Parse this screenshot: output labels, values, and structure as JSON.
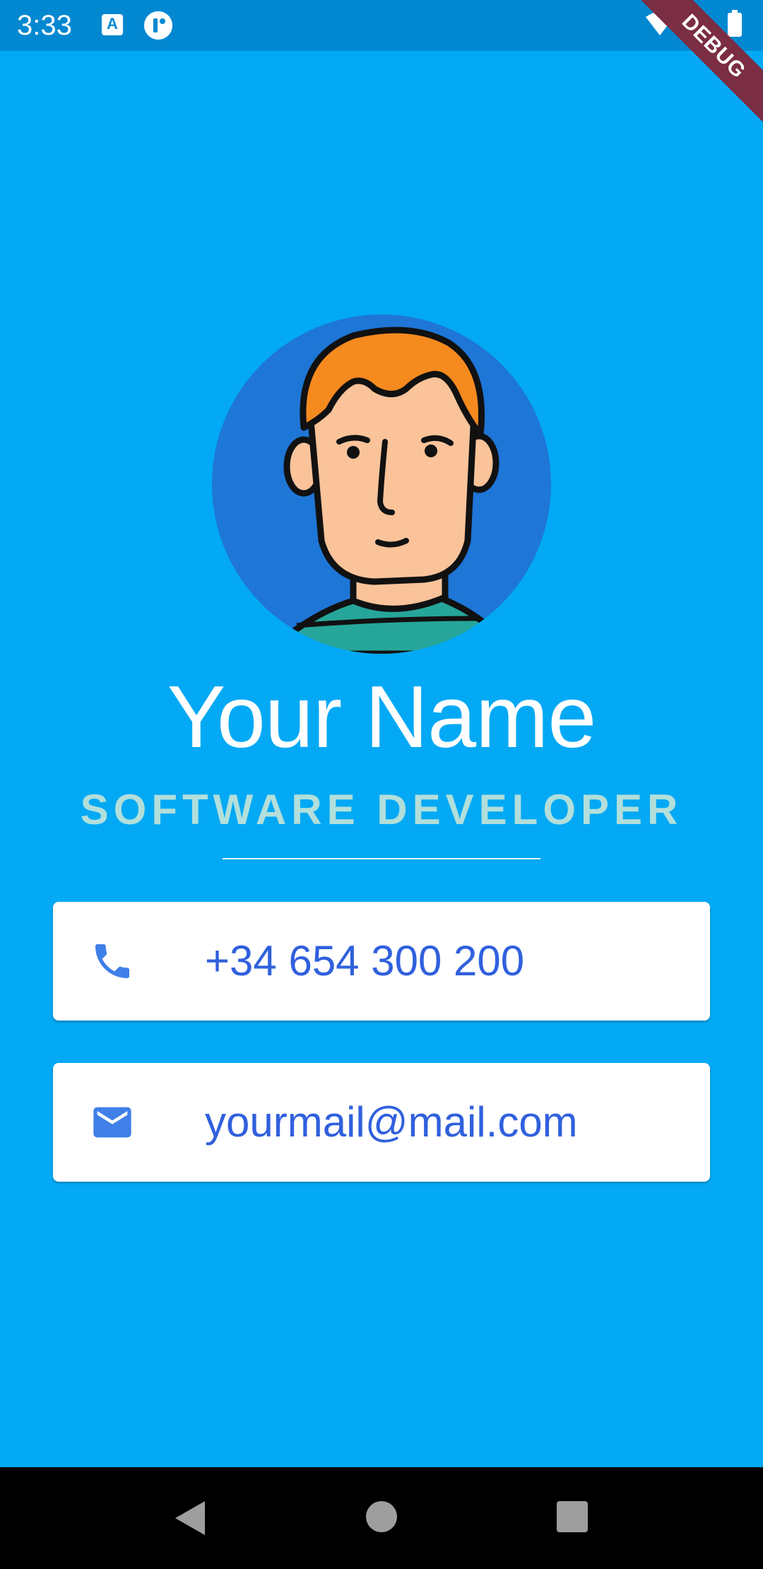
{
  "status_bar": {
    "time": "3:33",
    "notification_icons": [
      "a-icon",
      "t-icon"
    ],
    "system_icons": [
      "wifi-icon",
      "signal-icon",
      "battery-icon"
    ]
  },
  "debug_banner": "DEBUG",
  "profile": {
    "name": "Your Name",
    "title": "SOFTWARE DEVELOPER"
  },
  "contacts": {
    "phone": "+34 654 300 200",
    "email": "yourmail@mail.com"
  },
  "colors": {
    "background": "#03A9F4",
    "status_bar": "#0288D1",
    "avatar_circle": "#1E76D6",
    "title_text": "#B2DFDB",
    "contact_text": "#3060DD",
    "icon": "#3F7FE8",
    "debug_banner": "#7B2D43"
  },
  "nav_bar": {
    "buttons": [
      "back-icon",
      "home-icon",
      "recents-icon"
    ]
  }
}
